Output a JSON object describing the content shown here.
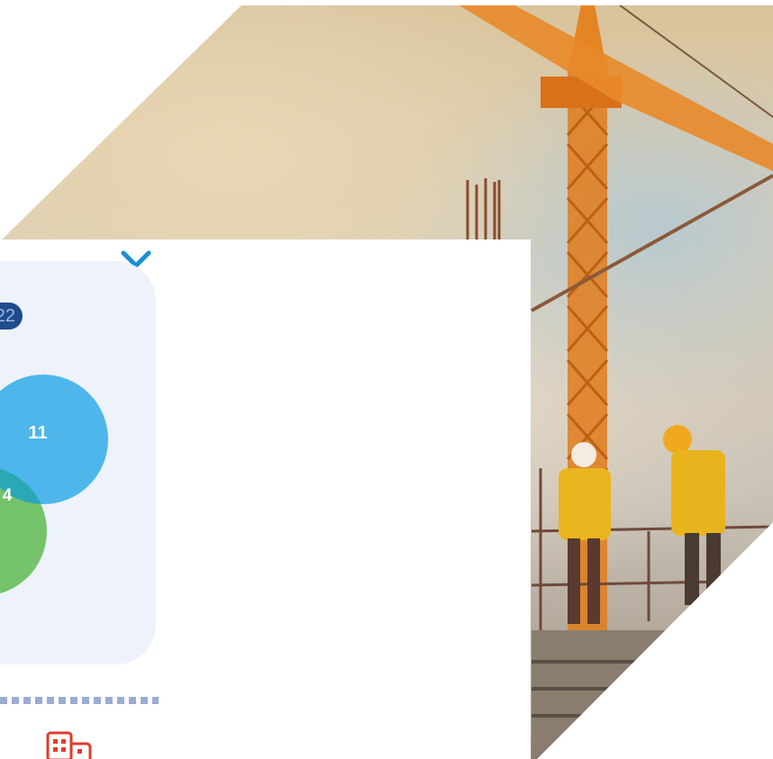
{
  "dropdown": {
    "icon": "chevron-down-icon"
  },
  "stats_card": {
    "year_badge": "22",
    "venn": {
      "large_circle_value": "11",
      "overlap_value": "4"
    },
    "colors": {
      "card_bg": "#eef2fb",
      "badge_bg": "#1f4c8e",
      "circle_blue": "#4eb6ea",
      "circle_green": "#75c36a",
      "overlap": "#2ba8b5"
    }
  },
  "footer": {
    "icon": "buildings-icon",
    "icon_color": "#e23b2e"
  },
  "hero_image": {
    "subject": "construction-crane-workers"
  }
}
